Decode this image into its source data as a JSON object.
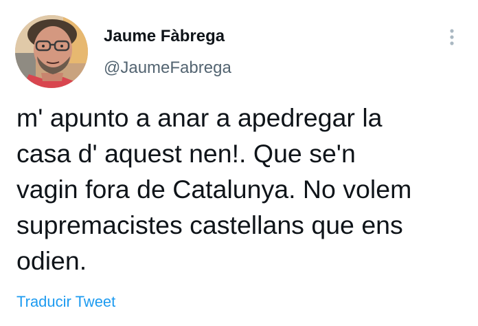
{
  "author": {
    "name": "Jaume Fàbrega",
    "handle": "@JaumeFabrega",
    "avatar_icon": "profile-photo"
  },
  "tweet": {
    "text": "m' apunto a anar a apedregar la\ncasa d' aquest nen!. Que se'n\nvagin fora de Catalunya. No volem\nsupremacistes castellans que ens\nodien."
  },
  "actions": {
    "more_icon": "vertical-ellipsis-icon",
    "translate_label": "Traducir Tweet"
  },
  "colors": {
    "text": "#0f1419",
    "secondary": "#536471",
    "link": "#1d9bf0",
    "menu_dots": "#aab8c2"
  }
}
